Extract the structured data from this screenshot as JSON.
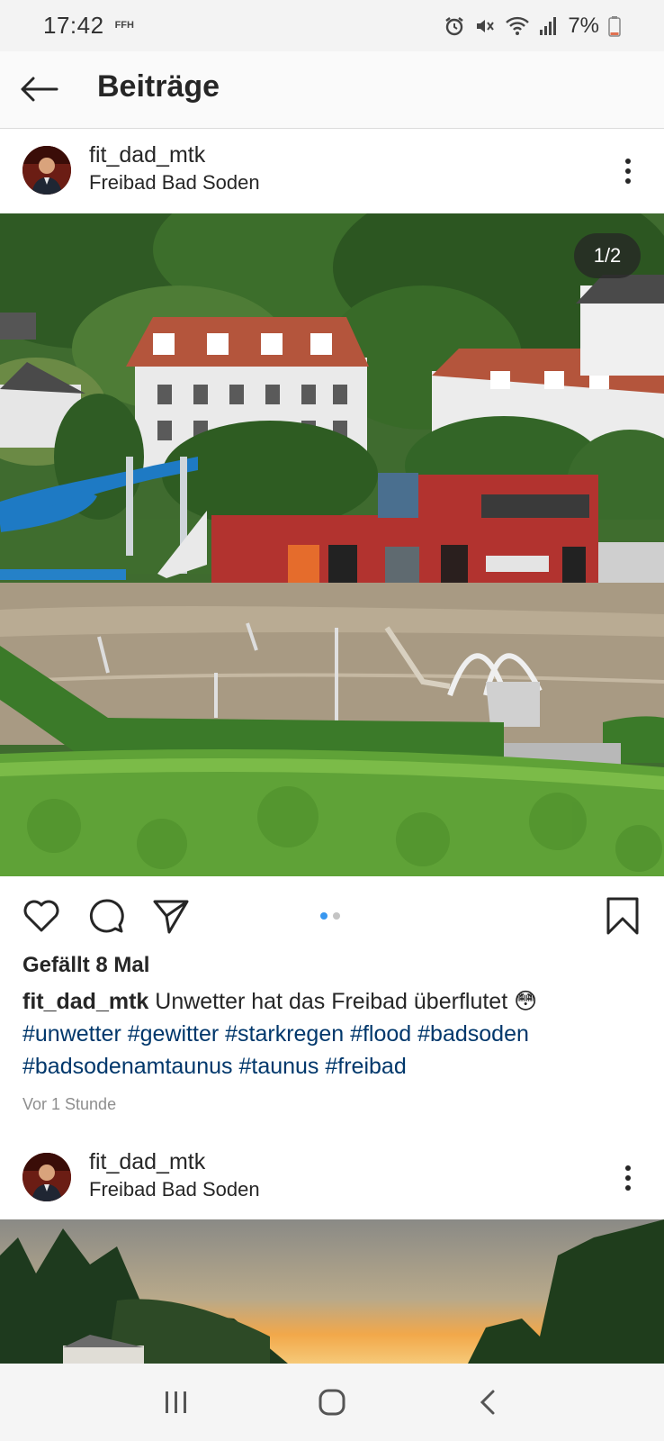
{
  "status_bar": {
    "time": "17:42",
    "app_badge": "FFH",
    "battery": "7%",
    "icons": [
      "alarm-icon",
      "mute-icon",
      "wifi-icon",
      "signal-icon",
      "battery-icon"
    ]
  },
  "header": {
    "title": "Beiträge",
    "back_icon": "arrow-left-icon"
  },
  "posts": [
    {
      "username": "fit_dad_mtk",
      "location": "Freibad Bad Soden",
      "page_indicator": "1/2",
      "likes": "Gefällt 8 Mal",
      "caption_user": "fit_dad_mtk",
      "caption_text": " Unwetter hat das Freibad überflutet 😳",
      "hashtags": "#unwetter #gewitter #starkregen #flood #badsoden #badsodenamtaunus #taunus #freibad",
      "time_ago": "Vor 1 Stunde",
      "carousel": {
        "count": 2,
        "active": 1
      }
    },
    {
      "username": "fit_dad_mtk",
      "location": "Freibad Bad Soden"
    }
  ],
  "actions": [
    "heart-icon",
    "comment-icon",
    "share-icon",
    "bookmark-icon"
  ],
  "nav_bar": [
    "recent-apps-icon",
    "home-icon",
    "back-icon"
  ],
  "colors": {
    "hashtag": "#00376b",
    "active_dot": "#3897f0",
    "status_bar_bg": "#f3f3f3"
  }
}
